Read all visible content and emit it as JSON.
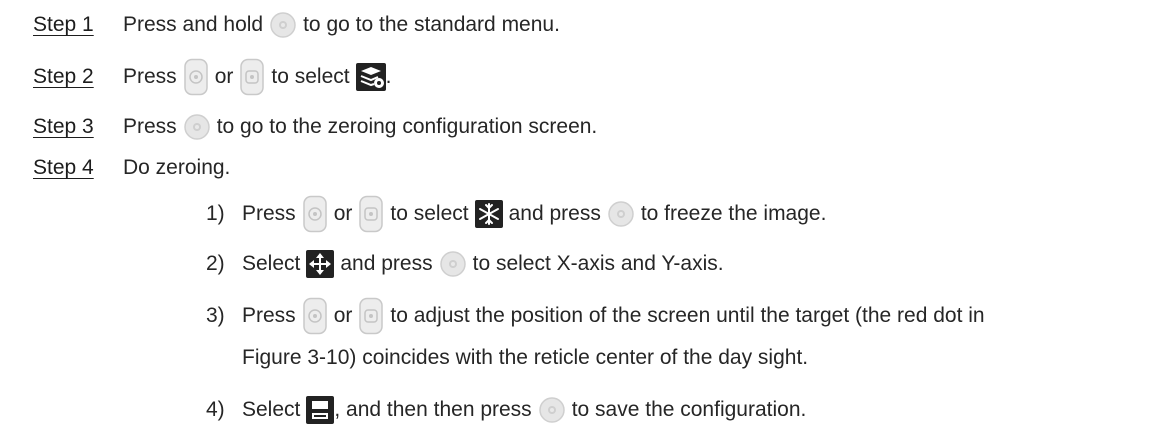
{
  "steps": [
    {
      "label": "Step 1",
      "parts": [
        "Press and hold",
        "to go to the standard menu."
      ]
    },
    {
      "label": "Step 2",
      "parts": [
        "Press",
        "or",
        "to select",
        "."
      ]
    },
    {
      "label": "Step 3",
      "parts": [
        "Press",
        "to go to the zeroing configuration screen."
      ]
    },
    {
      "label": "Step 4",
      "parts": [
        "Do zeroing."
      ]
    }
  ],
  "substeps": [
    {
      "num": "1)",
      "parts": [
        "Press",
        "or",
        "to select",
        "and press",
        "to freeze the image."
      ]
    },
    {
      "num": "2)",
      "parts": [
        "Select",
        "and press",
        "to select X-axis and Y-axis."
      ]
    },
    {
      "num": "3)",
      "parts": [
        "Press",
        "or",
        "to adjust the position of the screen until the target (the red dot in"
      ],
      "continuation": "Figure 3-10) coincides with the reticle center of the day sight."
    },
    {
      "num": "4)",
      "parts": [
        "Select",
        ", and then then press",
        "to save the configuration."
      ]
    }
  ],
  "icons": {
    "confirm_button": "round-menu-button-icon",
    "up_button": "up-rocker-button-icon",
    "down_button": "down-rocker-button-icon",
    "zeroing_menu": "zeroing-settings-icon",
    "freeze": "freeze-snowflake-icon",
    "move": "move-arrows-icon",
    "save": "save-disk-icon"
  },
  "colors": {
    "text": "#262626",
    "button_face": "#e3e3e3",
    "icon_dark": "#1f1f1f"
  }
}
